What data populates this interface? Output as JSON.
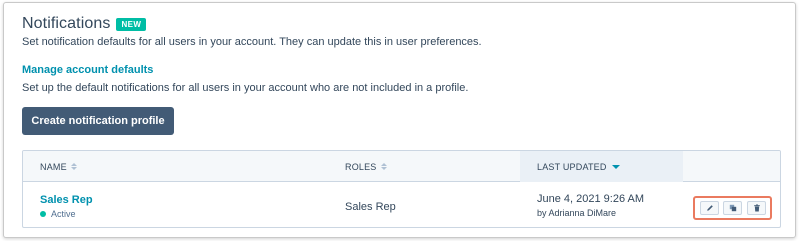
{
  "header": {
    "title": "Notifications",
    "badge": "NEW",
    "subtitle": "Set notification defaults for all users in your account. They can update this in user preferences."
  },
  "account_defaults": {
    "link_label": "Manage account defaults",
    "description": "Set up the default notifications for all users in your account who are not included in a profile."
  },
  "create_button_label": "Create notification profile",
  "table": {
    "columns": {
      "name": "NAME",
      "roles": "ROLES",
      "last_updated": "LAST UPDATED"
    },
    "sorted_column": "last_updated",
    "rows": [
      {
        "name": "Sales Rep",
        "status": "Active",
        "roles": "Sales Rep",
        "updated_date": "June 4, 2021 9:26 AM",
        "updated_by": "by Adrianna DiMare",
        "actions": [
          "pencil-icon",
          "clone-icon",
          "trash-icon"
        ]
      }
    ]
  },
  "colors": {
    "accent_teal": "#00bda5",
    "link": "#0091ae",
    "primary_button": "#425b76",
    "highlight": "#ea7a5f"
  }
}
